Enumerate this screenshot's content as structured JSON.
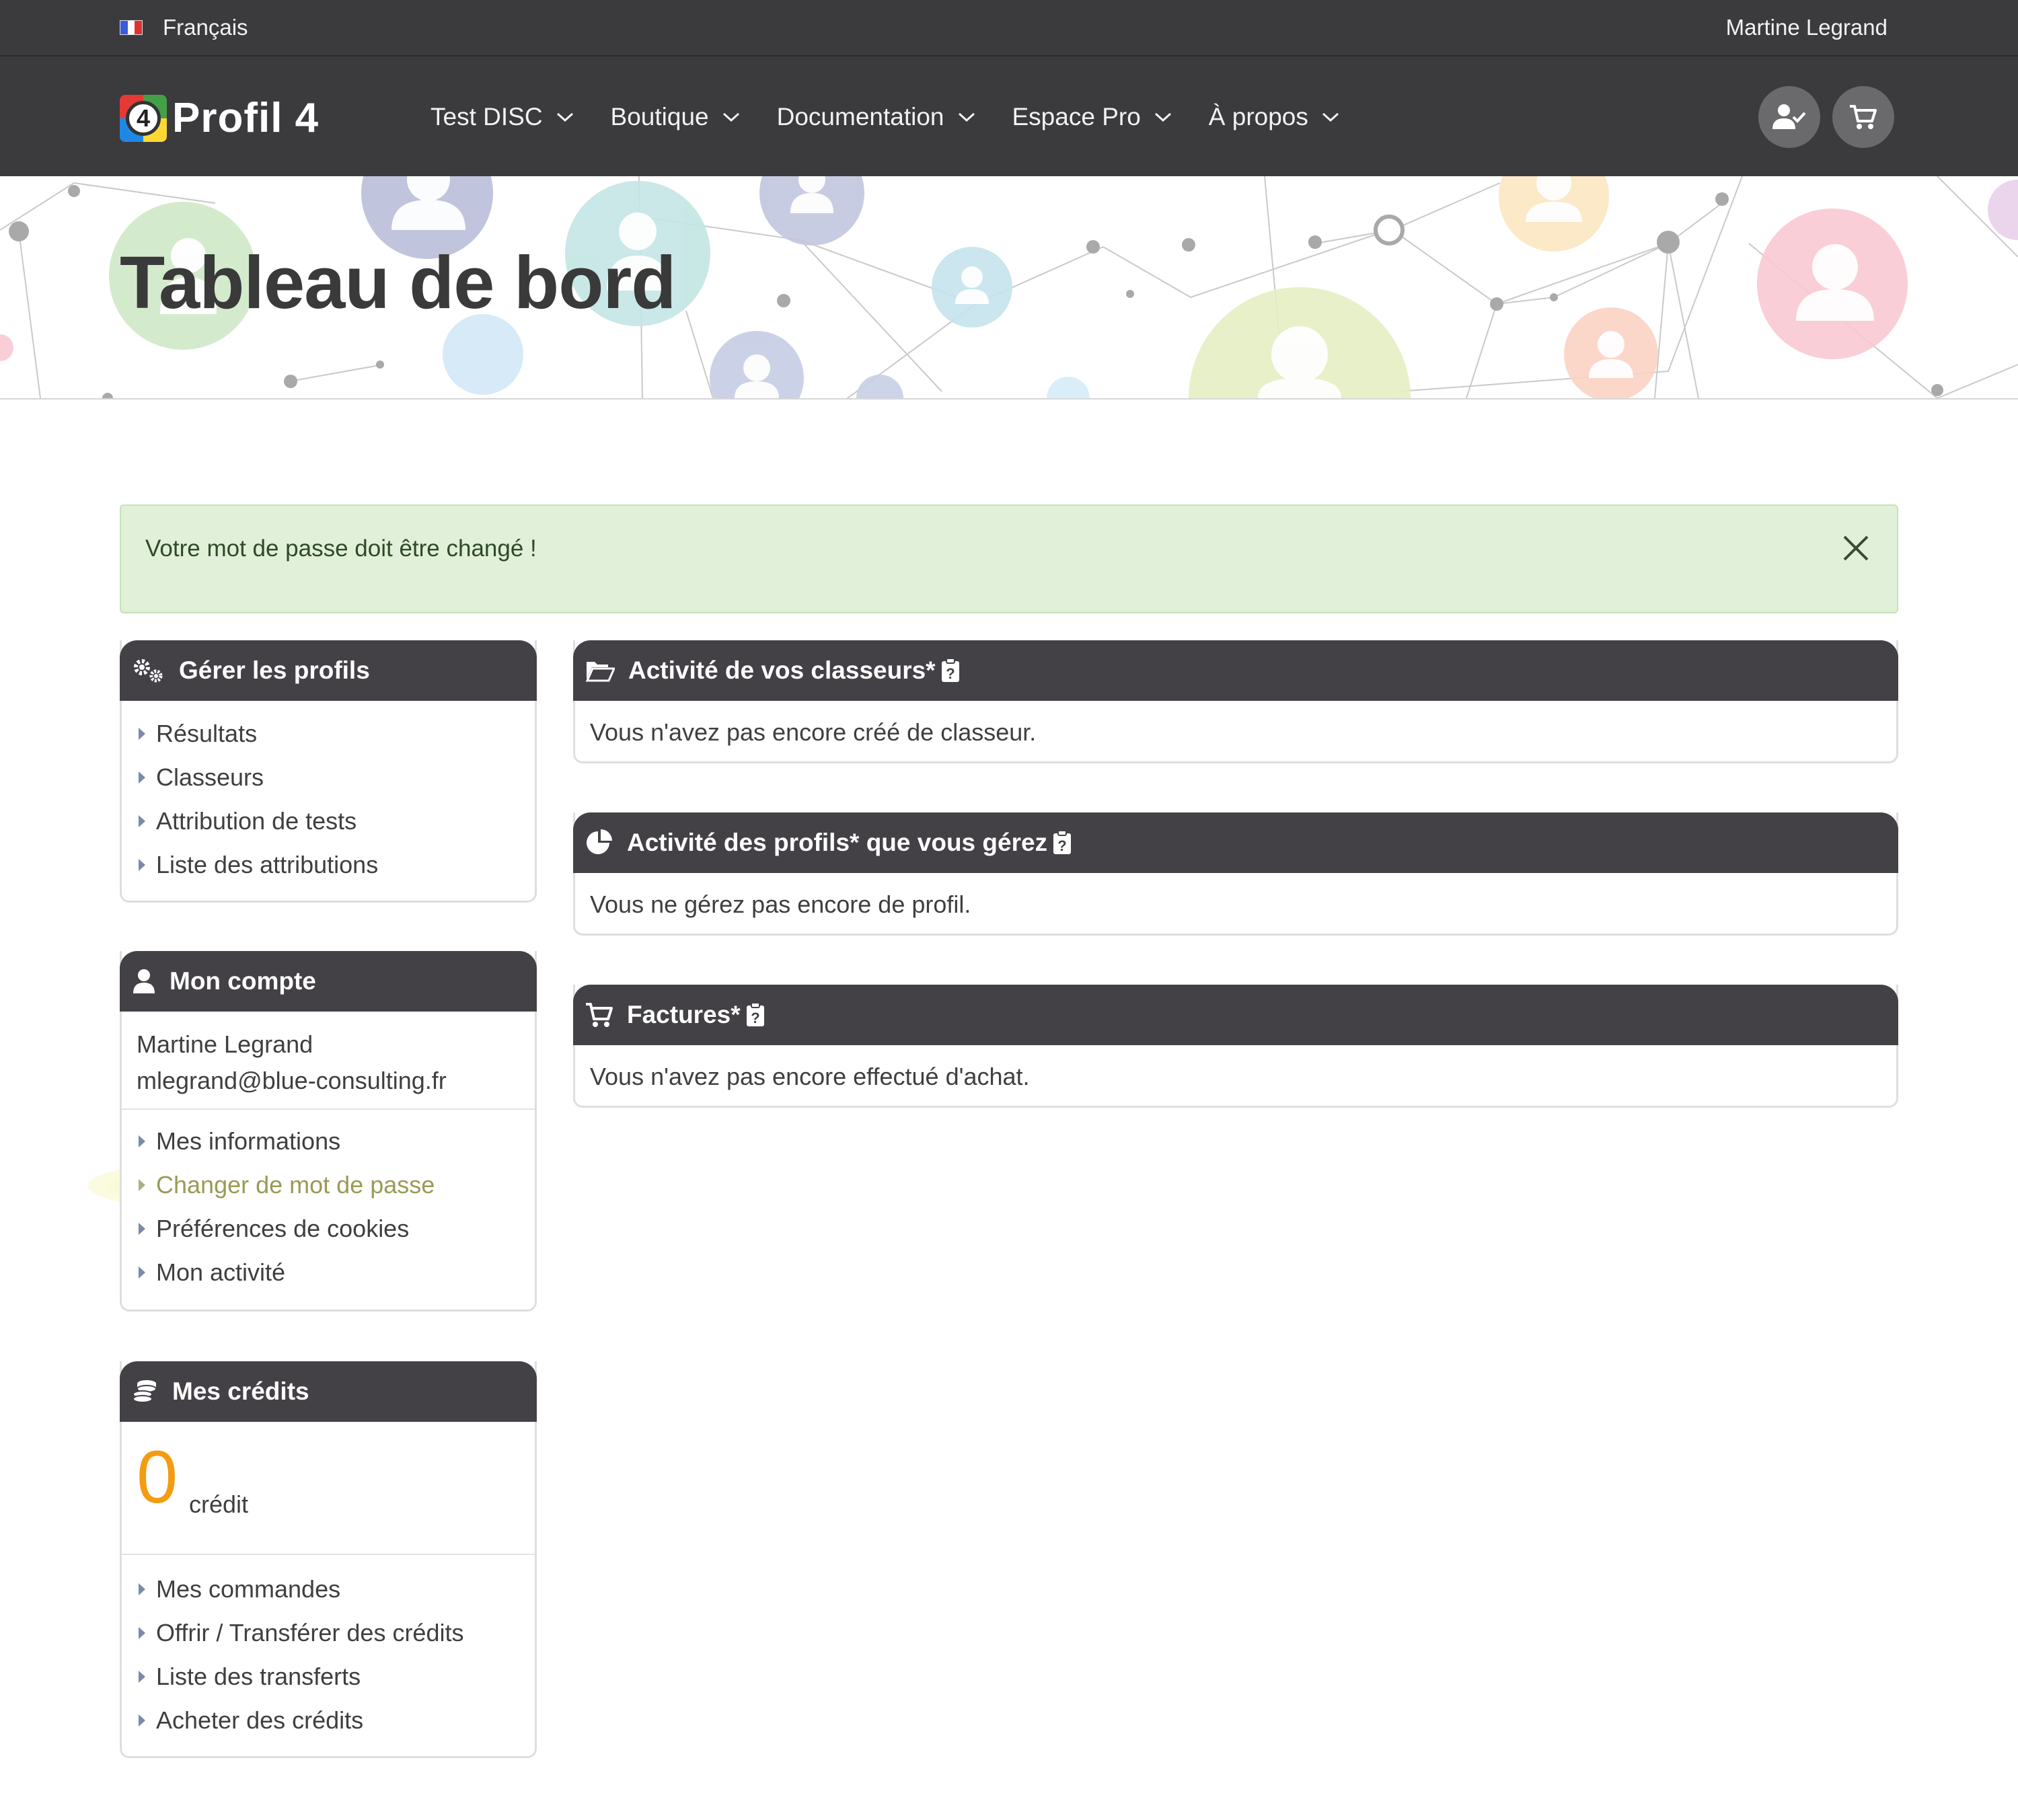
{
  "topbar": {
    "language": "Français",
    "flag_colors": [
      "#3b5bdb",
      "#ffffff",
      "#e03131"
    ],
    "user_name": "Martine Legrand"
  },
  "nav": {
    "logo_number": "4",
    "logo_text": "Profil 4",
    "logo_colors": [
      "#e53935",
      "#43a047",
      "#1e88e5",
      "#fdd835"
    ],
    "items": [
      {
        "label": "Test DISC"
      },
      {
        "label": "Boutique"
      },
      {
        "label": "Documentation"
      },
      {
        "label": "Espace Pro"
      },
      {
        "label": "À propos"
      }
    ],
    "icons": [
      "user-check-icon",
      "cart-icon"
    ]
  },
  "hero": {
    "title": "Tableau de bord"
  },
  "alert": {
    "message": "Votre mot de passe doit être changé !",
    "color": "#e1f0d8"
  },
  "panels": {
    "manage_profiles": {
      "title": "Gérer les profils",
      "icon": "cogs-icon",
      "links": [
        "Résultats",
        "Classeurs",
        "Attribution de tests",
        "Liste des attributions"
      ]
    },
    "account": {
      "title": "Mon compte",
      "icon": "user-icon",
      "name": "Martine Legrand",
      "email": "mlegrand@blue-consulting.fr",
      "links": [
        "Mes informations",
        "Changer de mot de passe",
        "Préférences de cookies",
        "Mon activité"
      ]
    },
    "credits": {
      "title": "Mes crédits",
      "icon": "coins-icon",
      "amount": "0",
      "unit": "crédit",
      "amount_color": "#f39c12",
      "links": [
        "Mes commandes",
        "Offrir / Transférer des crédits",
        "Liste des transferts",
        "Acheter des crédits"
      ]
    },
    "binders_activity": {
      "title": "Activité de vos classeurs*",
      "icon": "folder-open-icon",
      "text": "Vous n'avez pas encore créé de classeur."
    },
    "profiles_activity": {
      "title": "Activité des profils* que vous gérez",
      "icon": "pie-chart-icon",
      "text": "Vous ne gérez pas encore de profil."
    },
    "invoices": {
      "title": "Factures*",
      "icon": "cart-icon",
      "text": "Vous n'avez pas encore effectué d'achat."
    }
  }
}
